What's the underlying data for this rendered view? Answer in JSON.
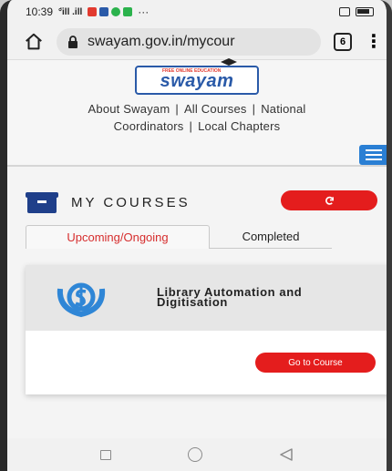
{
  "status_bar": {
    "time": "10:39",
    "signal_text": "°̈ill .ill",
    "extra": "···"
  },
  "browser": {
    "url": "swayam.gov.in/mycour",
    "tab_count": "6"
  },
  "site": {
    "logo_tagline": "FREE ONLINE EDUCATION",
    "logo_text": "swayam",
    "nav_line1": [
      "About Swayam",
      "All Courses",
      "National"
    ],
    "nav_line2": [
      "Coordinators",
      "Local Chapters"
    ],
    "separator": "|"
  },
  "courses": {
    "title": "MY COURSES",
    "tabs": [
      {
        "label": "Upcoming/Ongoing",
        "active": true
      },
      {
        "label": "Completed",
        "active": false
      }
    ],
    "list": [
      {
        "title_line1": "Library Automation and",
        "title_line2": "Digitisation",
        "button": "Go to Course"
      }
    ]
  },
  "colors": {
    "accent_red": "#e41d1d",
    "brand_blue": "#2a5aa8",
    "menu_blue": "#2a7fd4"
  }
}
